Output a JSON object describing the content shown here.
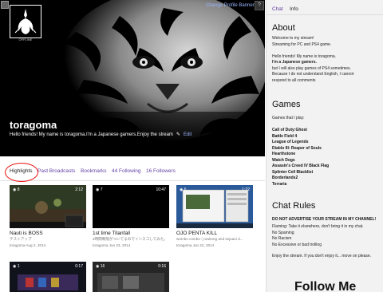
{
  "header": {
    "change_banner": "Change Profile Banner",
    "help_label": "?",
    "offline_label": "OFFLINE",
    "channel_name": "toragoma",
    "bio": "Hello friends! My name is toragoma.I'm a Japanese gamers.Enjoy the stream",
    "edit_label": "Edit"
  },
  "tabs": [
    "Highlights",
    "Past Broadcasts",
    "Bookmarks",
    "44 Following",
    "16 Followers"
  ],
  "videos": [
    {
      "views": "8",
      "duration": "2:12",
      "title": "Nauti is BOSS",
      "subtitle": "テストアップ",
      "date": "toragoma Aug 2, 2014"
    },
    {
      "views": "7",
      "duration": "10:47",
      "title": "1st time Titanfall",
      "subtitle": "4時間制限がついてるのでインスコしてみた。",
      "date": "toragoma Jun 23, 2014"
    },
    {
      "views": "6",
      "duration": "1:22",
      "title": "OJO PENTA KILL",
      "subtitle": "wombo combo :) wukong and sejuani d...",
      "date": "toragoma Jun 22, 2014"
    },
    {
      "views": "1",
      "duration": "0:17",
      "title": "",
      "subtitle": "",
      "date": ""
    },
    {
      "views": "16",
      "duration": "0:16",
      "title": "",
      "subtitle": "",
      "date": ""
    }
  ],
  "sidebar": {
    "tab_chat": "Chat",
    "tab_info": "Info",
    "about_title": "About",
    "about_lines": [
      "Welcome to my stream!",
      "Streaming for PC and PS4 game.",
      "",
      "Hello friends! My name is toragoma.",
      "I'm a Japanese gamers.",
      "but I will also play games of PS4 sometimes.",
      "Because I do not understand English, I cannot",
      "respond to all comments"
    ],
    "games_title": "Games",
    "games_intro": "Games that I play:",
    "games": [
      "Call of Duty:Ghost",
      "Battle Field 4",
      "League of Legends",
      "Diablo III: Reaper of Souls",
      "Hearthstone",
      "Watch Dogs",
      "Assasin's Creed IV Black Flag",
      "Splinter Cell Blacklist",
      "Borderlands2",
      "Terraria"
    ],
    "rules_title": "Chat Rules",
    "rules_header": "DO NOT ADVERTISE YOUR STREAM IN MY CHANNEL!",
    "rules": [
      "Flaming: Take it elsewhere, don't bring it in my chat.",
      "No Spaming",
      "No Racism",
      "No Excessive or bad trolling"
    ],
    "rules_footer": "Enjoy the stream. If you don't enjoy it... move on please.",
    "follow_me": "Follow Me"
  }
}
